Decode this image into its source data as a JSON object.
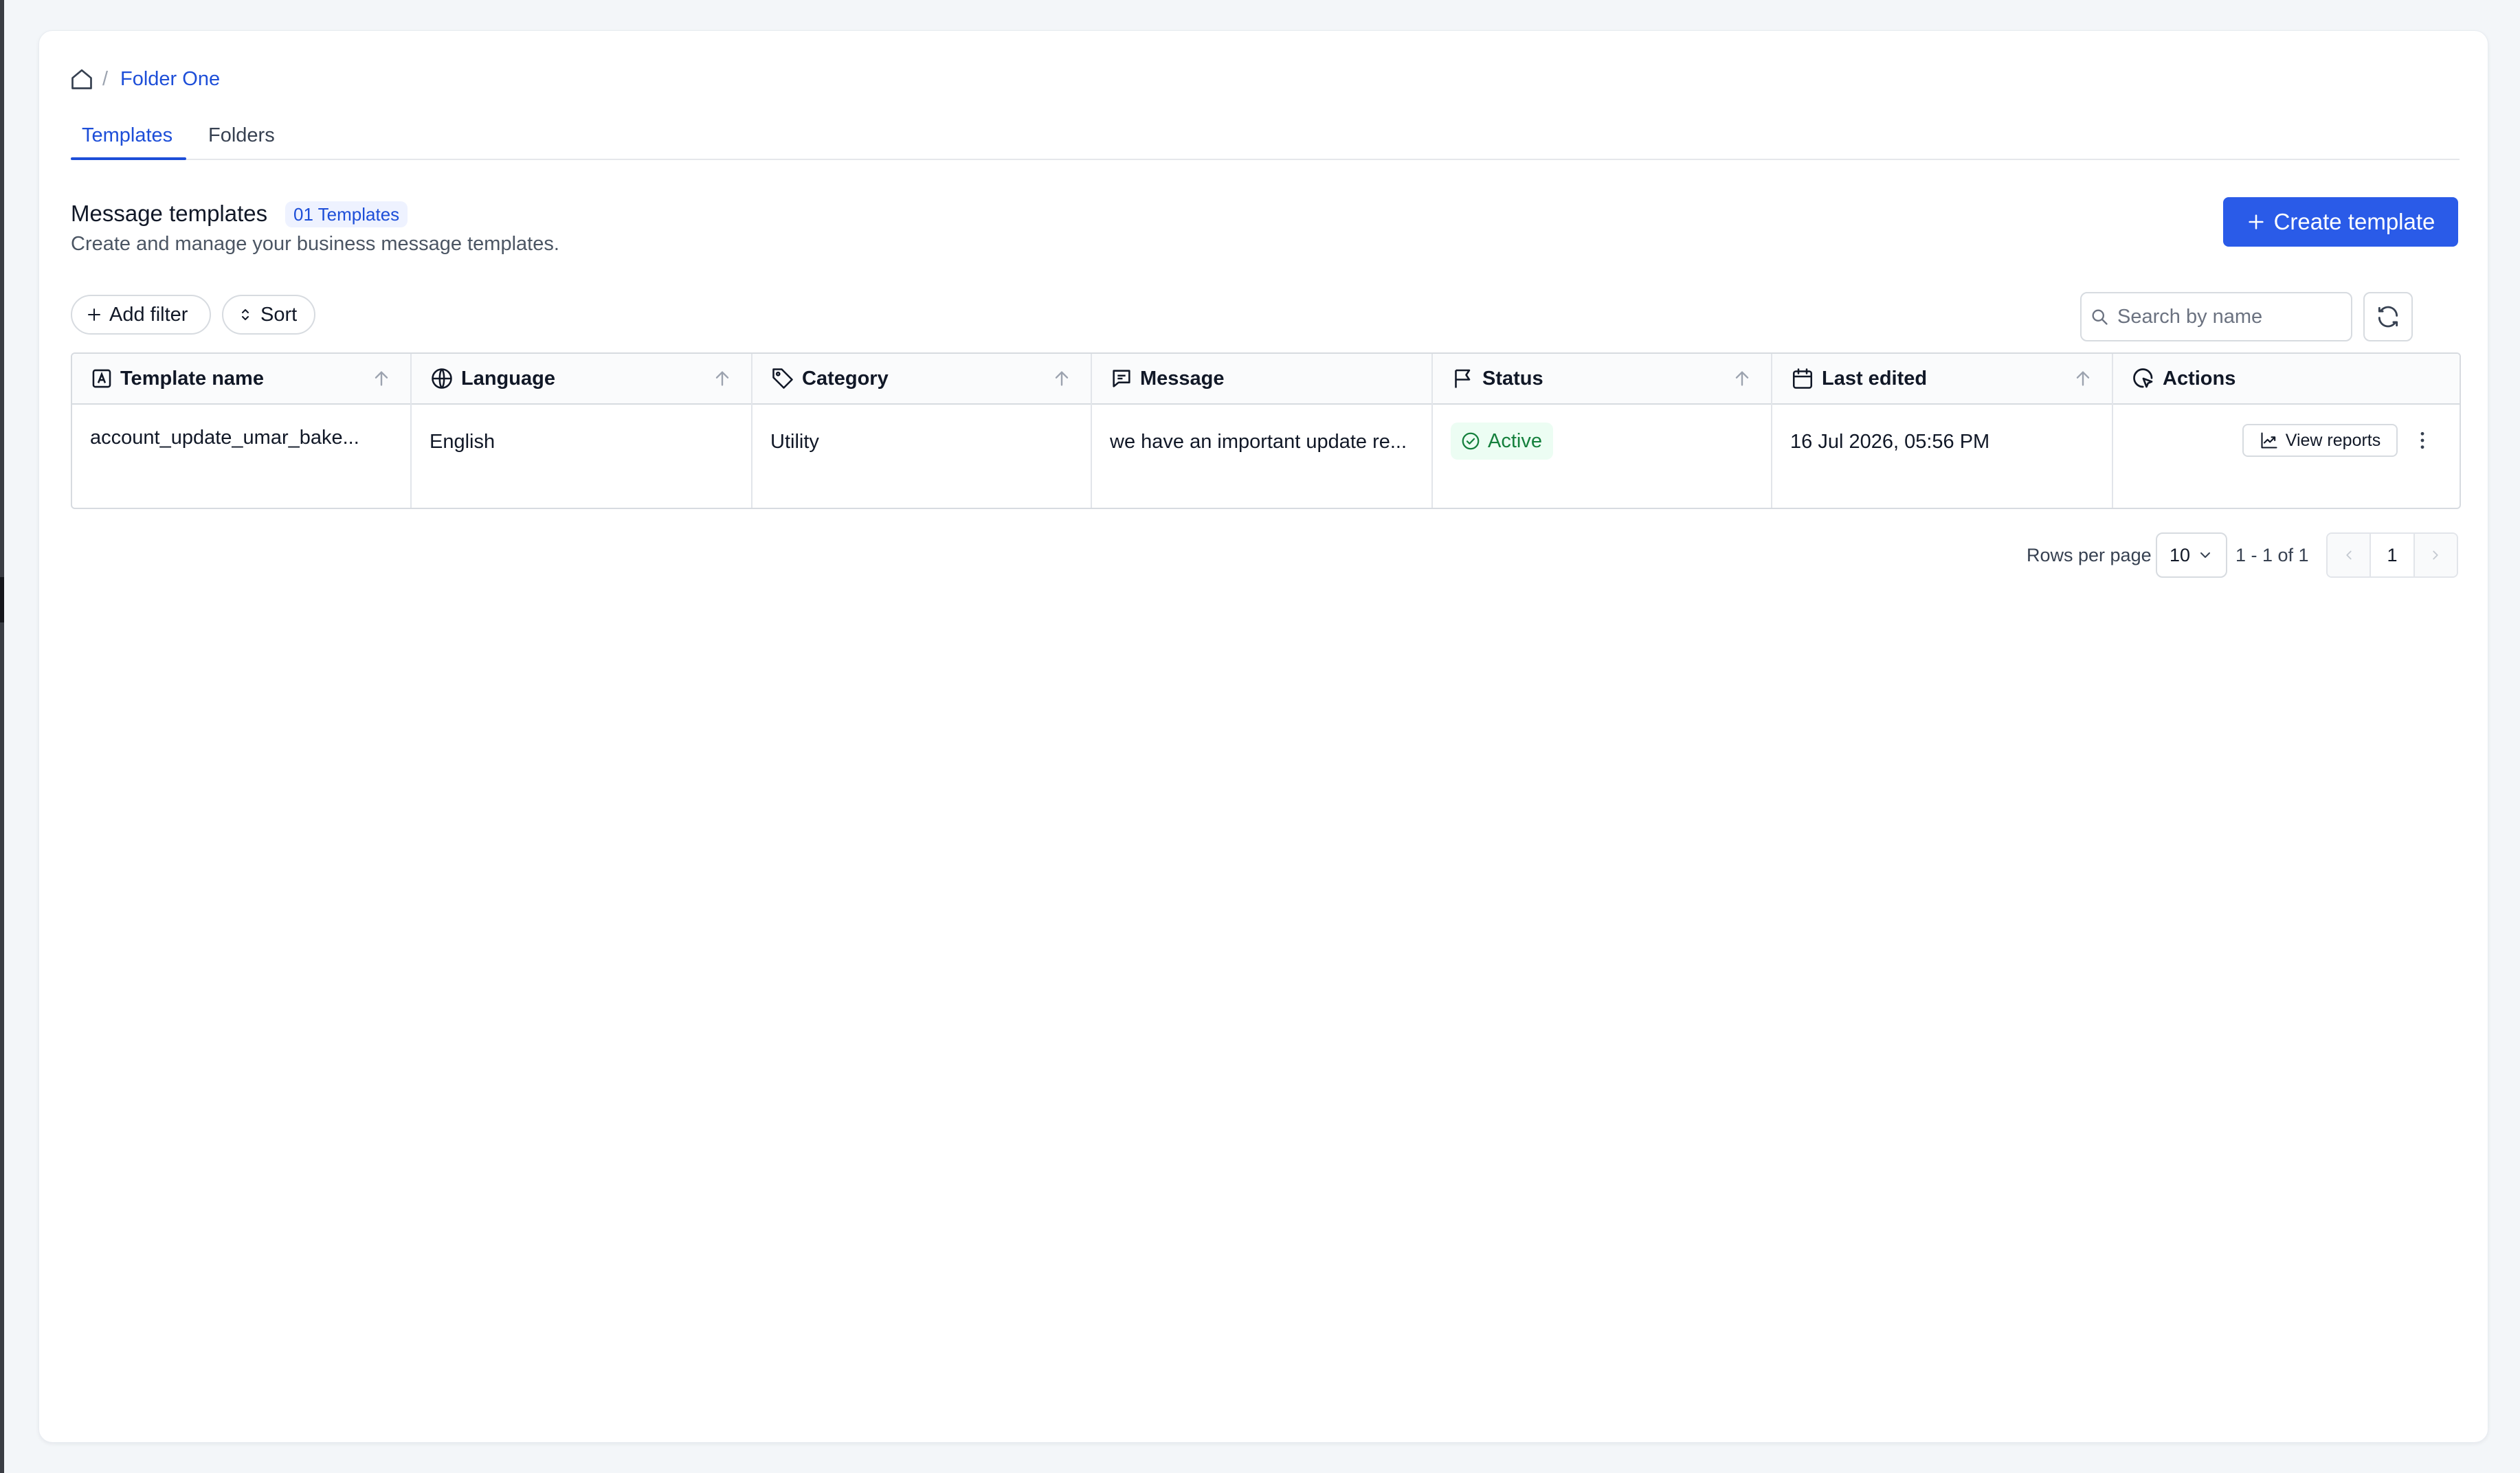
{
  "breadcrumb": {
    "separator": "/",
    "current": "Folder One"
  },
  "tabs": [
    {
      "label": "Templates",
      "active": true
    },
    {
      "label": "Folders",
      "active": false
    }
  ],
  "header": {
    "title": "Message templates",
    "count_badge": "01 Templates",
    "subtitle": "Create and manage your business message templates.",
    "create_label": "Create template"
  },
  "toolbar": {
    "add_filter_label": "Add filter",
    "sort_label": "Sort",
    "search_placeholder": "Search by name"
  },
  "table": {
    "columns": [
      {
        "label": "Template name",
        "icon": "template-icon",
        "sortable": true
      },
      {
        "label": "Language",
        "icon": "globe-icon",
        "sortable": true
      },
      {
        "label": "Category",
        "icon": "tag-icon",
        "sortable": true
      },
      {
        "label": "Message",
        "icon": "message-icon",
        "sortable": false
      },
      {
        "label": "Status",
        "icon": "flag-icon",
        "sortable": true
      },
      {
        "label": "Last edited",
        "icon": "calendar-icon",
        "sortable": true
      },
      {
        "label": "Actions",
        "icon": "cursor-click-icon",
        "sortable": false
      }
    ],
    "rows": [
      {
        "template_name": "account_update_umar_bake...",
        "language": "English",
        "category": "Utility",
        "message": "we have an important update re...",
        "status": "Active",
        "last_edited": "16 Jul 2026, 05:56 PM",
        "action_label": "View reports"
      }
    ]
  },
  "pagination": {
    "rows_per_page_label": "Rows per page",
    "rows_per_page_value": "10",
    "range": "1 - 1 of 1",
    "current_page": "1"
  },
  "colors": {
    "primary": "#2a5be8",
    "link": "#1d4ed8",
    "status_active_bg": "#ecfdf3",
    "status_active_text": "#15803d"
  }
}
